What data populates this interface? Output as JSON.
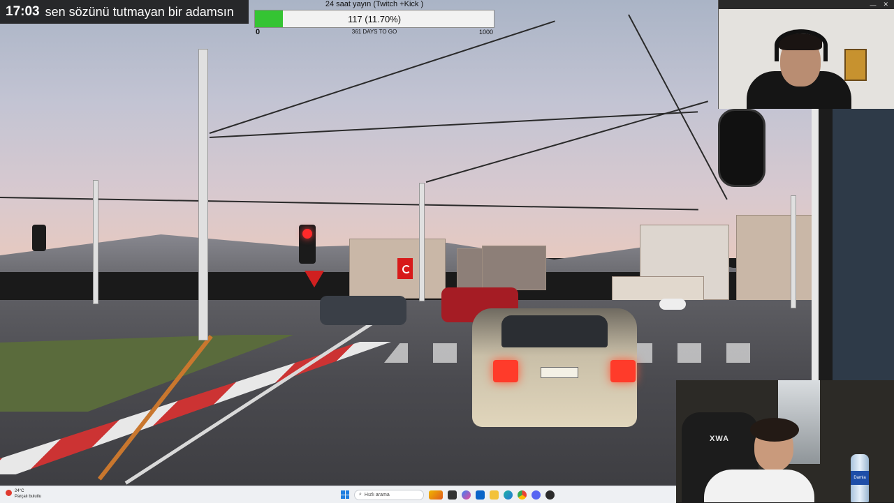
{
  "overlay": {
    "clock": "17:03",
    "message": "sen sözünü tutmayan bir adamsın"
  },
  "goal": {
    "title": "24 saat yayın (Twitch +Kick )",
    "value_text": "117 (11.70%)",
    "progress": 0.117,
    "min_label": "0",
    "sub_label": "361 DAYS TO GO",
    "max_label": "1000",
    "fill_color": "#35c433"
  },
  "webcam_top": {
    "minimize_icon": "minimize-icon",
    "close_icon": "close-icon"
  },
  "webcam_bottom": {
    "chair_brand": "XWA",
    "bottle_brand": "Damla"
  },
  "scene": {
    "plate_text": "44 LG"
  },
  "taskbar": {
    "weather_temp": "24°C",
    "weather_desc": "Parçalı bulutlu",
    "search_placeholder": "Hızlı arama",
    "icons": [
      "start-icon",
      "search-icon",
      "task-view-icon",
      "copilot-icon",
      "outlook-icon",
      "explorer-icon",
      "edge-icon",
      "chrome-icon",
      "discord-icon",
      "obs-icon"
    ]
  }
}
